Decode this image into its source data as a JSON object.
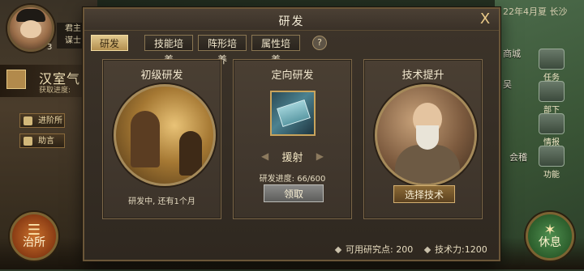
{
  "hud": {
    "level": "3",
    "ruler_line1": "君主",
    "ruler_line2": "谋士",
    "dynasty_name": "汉室气",
    "dynasty_progress": "获取进度:",
    "side_buttons": [
      "进阶所",
      "助言"
    ],
    "left_round_label": "治所",
    "right_round_label": "休息",
    "date": "22年4月夏 长沙",
    "right_menu": [
      "任务",
      "部下",
      "情报",
      "功能"
    ],
    "map_cities": [
      "商城",
      "吴",
      "会稽"
    ]
  },
  "dialog": {
    "title": "研发",
    "close_glyph": "X",
    "tabs": [
      {
        "label": "研发",
        "active": true
      },
      {
        "label": "技能培养",
        "active": false
      },
      {
        "label": "阵形培养",
        "active": false
      },
      {
        "label": "属性培养",
        "active": false
      }
    ],
    "help_glyph": "?",
    "panels": {
      "basic": {
        "title": "初级研发",
        "status": "研发中, 还有1个月"
      },
      "directed": {
        "title": "定向研发",
        "skill": "援射",
        "progress_label": "研发进度:",
        "progress_value": "66/600",
        "progress_fraction": 0.11,
        "button": "领取",
        "arrow_left": "◀",
        "arrow_right": "▶"
      },
      "upgrade": {
        "title": "技术提升",
        "button": "选择技术"
      }
    },
    "footer": {
      "available_label": "可用研究点:",
      "available_value": "200",
      "power_label": "技术力:",
      "power_value": "1200"
    }
  },
  "colors": {
    "tab_active": "#e2c98e",
    "panel_bg": "#4a3f33",
    "gold_button": "#8b6a36",
    "gray_button": "#8a8a88"
  }
}
